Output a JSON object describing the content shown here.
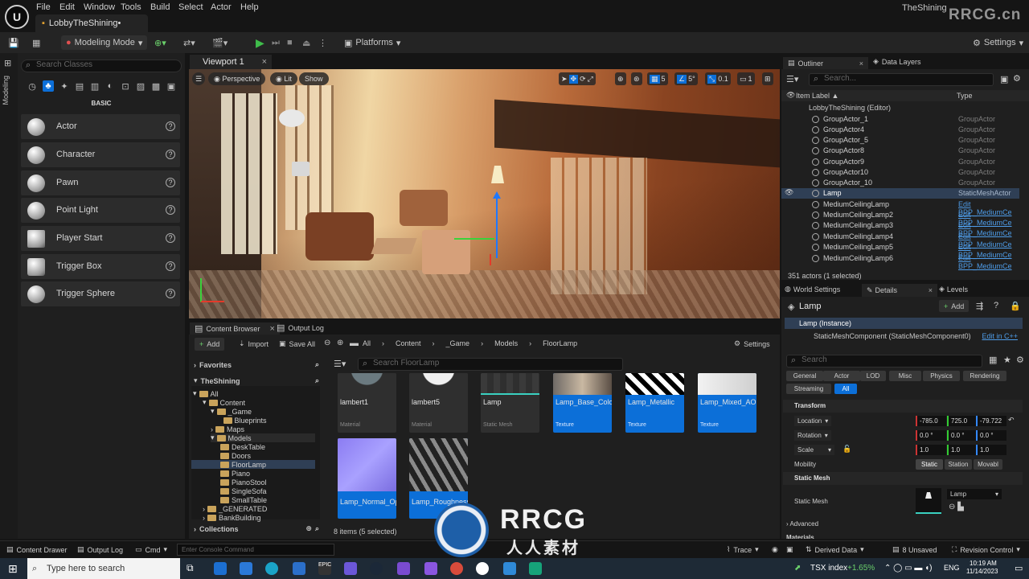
{
  "menubar": {
    "logo": "U",
    "items": [
      "File",
      "Edit",
      "Window",
      "Tools",
      "Build",
      "Select",
      "Actor",
      "Help"
    ],
    "document_tab": "LobbyTheShining•",
    "project_name": "TheShining",
    "watermark": "RRCG.cn"
  },
  "toolbar": {
    "mode": "Modeling Mode",
    "platforms": "Platforms",
    "settings": "Settings"
  },
  "left_panel": {
    "strip_label": "Modeling",
    "search_placeholder": "Search Classes",
    "category": "BASIC",
    "items": [
      "Actor",
      "Character",
      "Pawn",
      "Point Light",
      "Player Start",
      "Trigger Box",
      "Trigger Sphere"
    ]
  },
  "viewport": {
    "tab": "Viewport 1",
    "perspective": "Perspective",
    "lit": "Lit",
    "show": "Show",
    "grid_value": "5",
    "angle_value": "5°",
    "scale_value": "0.1",
    "camera_value": "1"
  },
  "content_browser": {
    "tab": "Content Browser",
    "tab2": "Output Log",
    "add": "Add",
    "import": "Import",
    "save_all": "Save All",
    "path": [
      "All",
      "Content",
      "_Game",
      "Models",
      "FloorLamp"
    ],
    "settings": "Settings",
    "favorites": "Favorites",
    "project": "TheShining",
    "search_placeholder": "Search FloorLamp",
    "collections": "Collections",
    "status": "8 items (5 selected)",
    "tree": [
      "All",
      "Content",
      "_Game",
      "Blueprints",
      "Maps",
      "Models",
      "DeskTable",
      "Doors",
      "FloorLamp",
      "Piano",
      "PianoStool",
      "SingleSofa",
      "SmallTable",
      "_GENERATED",
      "BankBuilding"
    ],
    "assets": [
      {
        "name": "lambert1",
        "kind": "Material"
      },
      {
        "name": "lambert5",
        "kind": "Material"
      },
      {
        "name": "Lamp",
        "kind": "Static Mesh"
      },
      {
        "name": "Lamp_Base_Color",
        "kind": "Texture"
      },
      {
        "name": "Lamp_Metallic",
        "kind": "Texture"
      },
      {
        "name": "Lamp_Mixed_AO",
        "kind": "Texture"
      },
      {
        "name": "Lamp_Normal_OpenGL",
        "kind": ""
      },
      {
        "name": "Lamp_Roughness",
        "kind": ""
      }
    ]
  },
  "outliner": {
    "tab": "Outliner",
    "tab2": "Data Layers",
    "search_placeholder": "Search...",
    "col_label": "Item Label ▲",
    "col_type": "Type",
    "root": "LobbyTheShining (Editor)",
    "rows": [
      {
        "name": "GroupActor_1",
        "type": "GroupActor"
      },
      {
        "name": "GroupActor4",
        "type": "GroupActor"
      },
      {
        "name": "GroupActor_5",
        "type": "GroupActor"
      },
      {
        "name": "GroupActor8",
        "type": "GroupActor"
      },
      {
        "name": "GroupActor9",
        "type": "GroupActor"
      },
      {
        "name": "GroupActor10",
        "type": "GroupActor"
      },
      {
        "name": "GroupActor_10",
        "type": "GroupActor"
      },
      {
        "name": "Lamp",
        "type": "StaticMeshActor"
      },
      {
        "name": "MediumCeilingLamp",
        "type": "Edit BPP_MediumCe"
      },
      {
        "name": "MediumCeilingLamp2",
        "type": "Edit BPP_MediumCe"
      },
      {
        "name": "MediumCeilingLamp3",
        "type": "Edit BPP_MediumCe"
      },
      {
        "name": "MediumCeilingLamp4",
        "type": "Edit BPP_MediumCe"
      },
      {
        "name": "MediumCeilingLamp5",
        "type": "Edit BPP_MediumCe"
      },
      {
        "name": "MediumCeilingLamp6",
        "type": "Edit BPP_MediumCe"
      }
    ],
    "status": "351 actors (1 selected)"
  },
  "details": {
    "tab_world": "World Settings",
    "tab_details": "Details",
    "tab_levels": "Levels",
    "actor_name": "Lamp",
    "add": "Add",
    "instance": "Lamp (Instance)",
    "component": "StaticMeshComponent (StaticMeshComponent0)",
    "edit_cpp": "Edit in C++",
    "search_placeholder": "Search",
    "filters": [
      "General",
      "Actor",
      "LOD",
      "Misc",
      "Physics",
      "Rendering",
      "Streaming",
      "All"
    ],
    "transform": "Transform",
    "location": "Location",
    "rotation": "Rotation",
    "scale": "Scale",
    "loc": [
      "-785.0",
      "725.0",
      "-79.722"
    ],
    "rot": [
      "0.0 °",
      "0.0 °",
      "0.0 °"
    ],
    "scl": [
      "1.0",
      "1.0",
      "1.0"
    ],
    "mobility": "Mobility",
    "mobility_opts": [
      "Static",
      "Station",
      "Movabl"
    ],
    "static_mesh_section": "Static Mesh",
    "static_mesh_label": "Static Mesh",
    "static_mesh_value": "Lamp",
    "advanced": "Advanced",
    "materials": "Materials"
  },
  "statusbar": {
    "content_drawer": "Content Drawer",
    "output_log": "Output Log",
    "cmd": "Cmd",
    "console_placeholder": "Enter Console Command",
    "trace": "Trace",
    "derived_data": "Derived Data",
    "unsaved": "8 Unsaved",
    "revision": "Revision Control"
  },
  "taskbar": {
    "search_placeholder": "Type here to search",
    "stock": "TSX index",
    "stock_change": "+1.65%",
    "lang": "ENG",
    "time": "10:19 AM",
    "date": "11/14/2023",
    "watermark_big": "RRCG",
    "watermark_sub": "人人素材"
  }
}
